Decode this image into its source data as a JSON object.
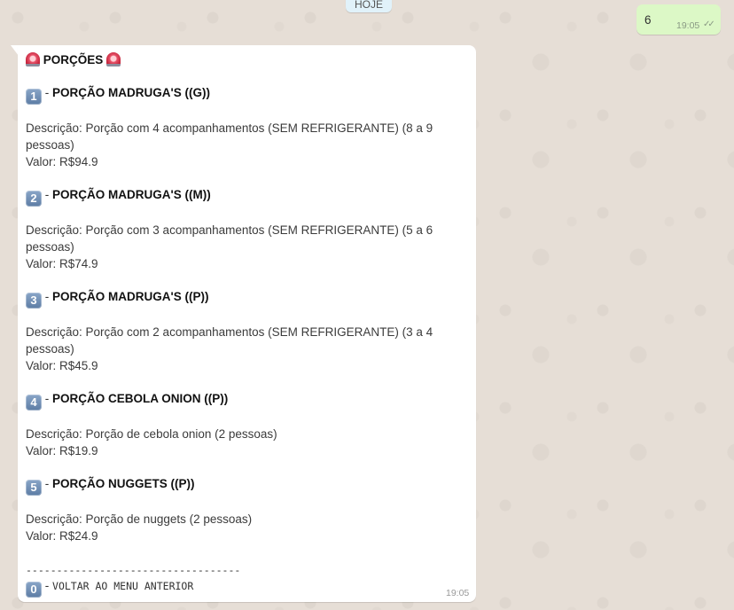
{
  "date_pill": "HOJE",
  "outgoing": {
    "text": "6",
    "time": "19:05",
    "ticks": "✓✓"
  },
  "incoming": {
    "title": "PORÇÕES",
    "items": [
      {
        "key": "1",
        "title": "PORÇÃO MADRUGA'S ((G))",
        "desc_l1": "Descrição: Porção com 4 acompanhamentos (SEM REFRIGERANTE) (8 a 9",
        "desc_l2": "pessoas)",
        "value": "Valor: R$94.9"
      },
      {
        "key": "2",
        "title": "PORÇÃO MADRUGA'S ((M))",
        "desc_l1": "Descrição: Porção com 3 acompanhamentos (SEM REFRIGERANTE) (5 a 6",
        "desc_l2": "pessoas)",
        "value": "Valor: R$74.9"
      },
      {
        "key": "3",
        "title": "PORÇÃO MADRUGA'S ((P))",
        "desc_l1": "Descrição: Porção com 2 acompanhamentos (SEM REFRIGERANTE) (3 a 4",
        "desc_l2": "pessoas)",
        "value": "Valor: R$45.9"
      },
      {
        "key": "4",
        "title": "PORÇÃO CEBOLA ONION ((P))",
        "desc_l1": "Descrição: Porção de cebola onion (2 pessoas)",
        "value": "Valor: R$19.9"
      },
      {
        "key": "5",
        "title": "PORÇÃO NUGGETS ((P))",
        "desc_l1": "Descrição: Porção de nuggets (2 pessoas)",
        "value": "Valor: R$24.9"
      }
    ],
    "separator": "-----------------------------------",
    "back_key": "0",
    "back_label": "VOLTAR AO MENU ANTERIOR",
    "time": "19:05"
  },
  "icons": {
    "siren": "police-car-light-icon",
    "keycap": "keycap-digit-icon"
  },
  "colors": {
    "bg": "#e5ddd5",
    "incoming": "#ffffff",
    "outgoing": "#dcf8c6",
    "date_pill": "#e1f2fa"
  }
}
